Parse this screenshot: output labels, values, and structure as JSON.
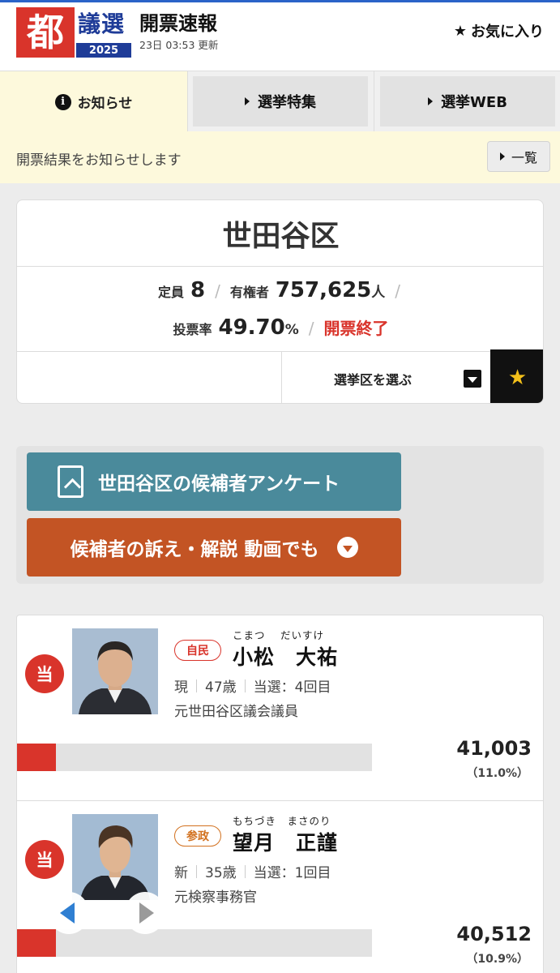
{
  "header": {
    "logo_char": "都",
    "logo_word": "議選",
    "logo_year": "2025",
    "title": "開票速報",
    "updated": "23日 03:53 更新",
    "favorite_label": "お気に入り"
  },
  "tabs": {
    "notice": "お知らせ",
    "feature": "選挙特集",
    "web": "選挙WEB"
  },
  "notice": {
    "text": "開票結果をお知らせします",
    "list_label": "一覧"
  },
  "district": {
    "name": "世田谷区",
    "seats_label": "定員",
    "seats": "8",
    "voters_label": "有権者",
    "voters": "757,625",
    "voters_unit": "人",
    "turnout_label": "投票率",
    "turnout": "49.70",
    "turnout_unit": "%",
    "status": "開票終了",
    "select_label": "選挙区を選ぶ"
  },
  "actions": {
    "survey_label": "世田谷区の候補者アンケート",
    "video_label": "候補者の訴え・解説 動画でも"
  },
  "candidates": [
    {
      "elected_mark": "当",
      "party": "自民",
      "kana": "こまつ　 だいすけ",
      "name": "小松　大祐",
      "status": "現",
      "age": "47歳",
      "wins": "当選：4回目",
      "career": "元世田谷区議会議員",
      "votes": "41,003",
      "pct": "（11.0%）",
      "share": 11.0
    },
    {
      "elected_mark": "当",
      "party": "参政",
      "kana": "もちづき　まさのり",
      "name": "望月　正謹",
      "status": "新",
      "age": "35歳",
      "wins": "当選：1回目",
      "career": "元検察事務官",
      "votes": "40,512",
      "pct": "（10.9%）",
      "share": 10.9
    }
  ],
  "colors": {
    "accent_red": "#d9342b",
    "brand_blue": "#1f3c98",
    "survey_teal": "#4a8a9b",
    "video_orange": "#c35424",
    "star_gold": "#f3c01a"
  }
}
